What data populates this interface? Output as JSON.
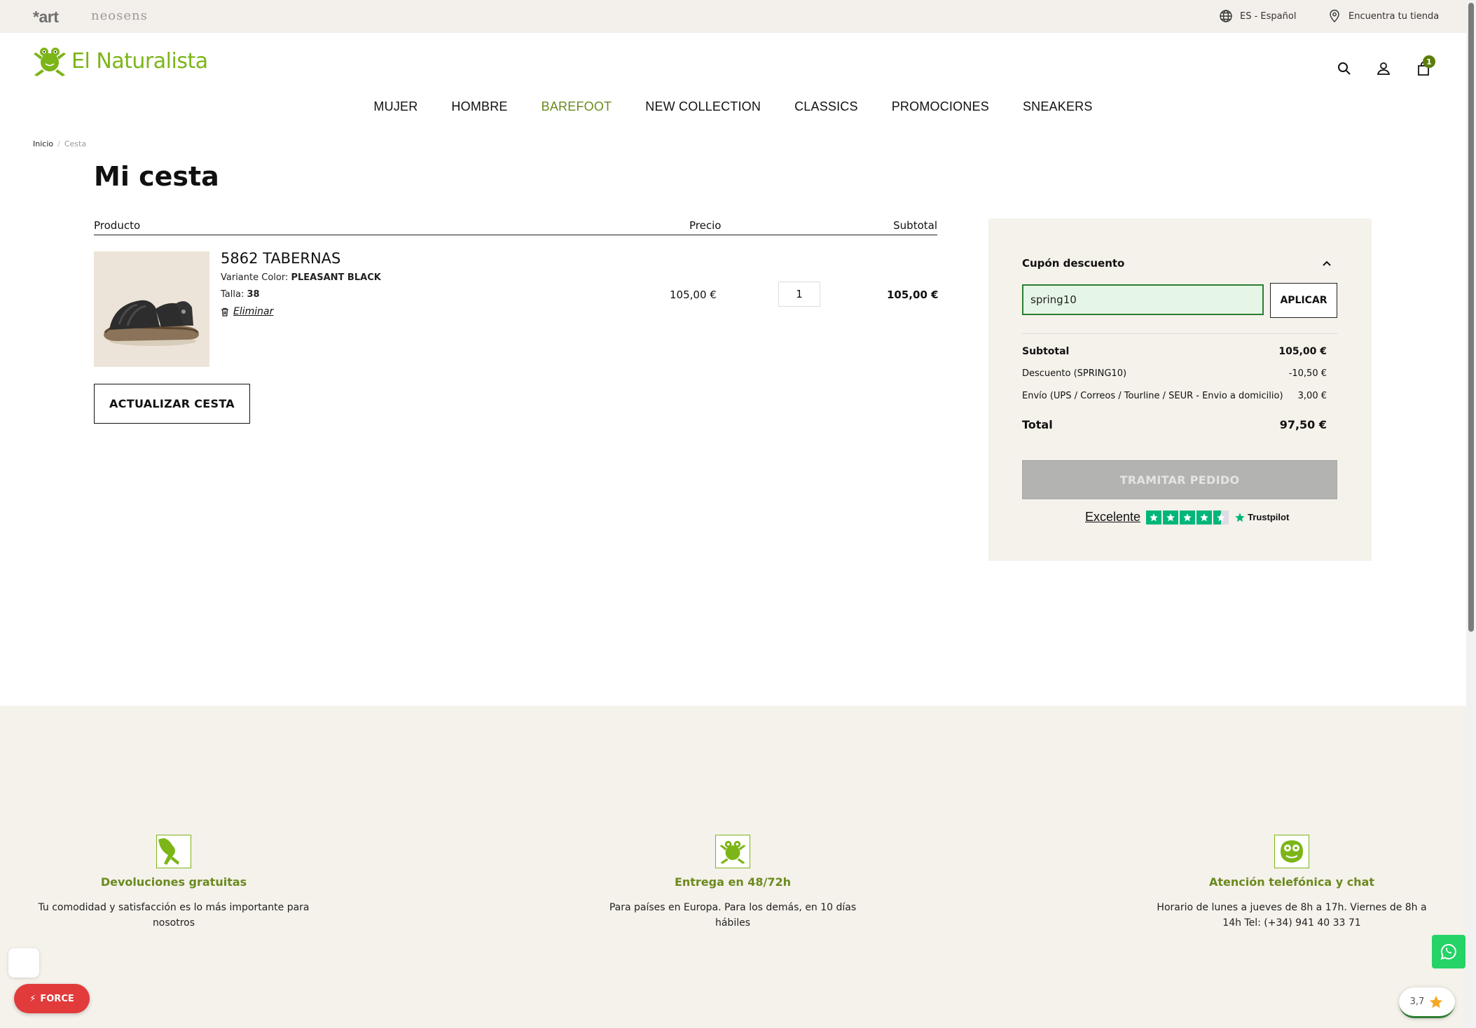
{
  "topbar": {
    "brand_art": "*art",
    "brand_neosens": "neosens",
    "language": "ES - Español",
    "store_locator": "Encuentra tu tienda"
  },
  "header": {
    "logo_text": "El Naturalista",
    "cart_count": "1"
  },
  "nav": {
    "items": [
      {
        "label": "MUJER"
      },
      {
        "label": "HOMBRE"
      },
      {
        "label": "BAREFOOT"
      },
      {
        "label": "NEW COLLECTION"
      },
      {
        "label": "CLASSICS"
      },
      {
        "label": "PROMOCIONES"
      },
      {
        "label": "SNEAKERS"
      }
    ]
  },
  "breadcrumb": {
    "home": "Inicio",
    "sep": "/",
    "current": "Cesta"
  },
  "page_title": "Mi cesta",
  "cart": {
    "columns": {
      "product": "Producto",
      "price": "Precio",
      "subtotal": "Subtotal"
    },
    "item": {
      "name": "5862 TABERNAS",
      "variant_label": "Variante Color:",
      "variant_value": "PLEASANT BLACK",
      "size_label": "Talla:",
      "size_value": "38",
      "remove": "Eliminar",
      "price": "105,00 €",
      "qty": "1",
      "subtotal": "105,00 €"
    },
    "update_button": "ACTUALIZAR CESTA"
  },
  "summary": {
    "coupon_title": "Cupón descuento",
    "coupon_value": "spring10",
    "apply_button": "APLICAR",
    "subtotal_label": "Subtotal",
    "subtotal_value": "105,00 €",
    "discount_label": "Descuento (SPRING10)",
    "discount_value": "-10,50 €",
    "shipping_label": "Envío (UPS / Correos / Tourline / SEUR - Envio a domicilio)",
    "shipping_value": "3,00 €",
    "total_label": "Total",
    "total_value": "97,50 €",
    "checkout_button": "TRAMITAR PEDIDO",
    "trustpilot_word": "Excelente",
    "trustpilot_brand": "Trustpilot"
  },
  "features": [
    {
      "title": "Devoluciones gratuitas",
      "desc": "Tu comodidad y satisfacción es lo más importante para nosotros"
    },
    {
      "title": "Entrega en 48/72h",
      "desc": "Para países en Europa. Para los demás, en 10 días hábiles"
    },
    {
      "title": "Atención telefónica y chat",
      "desc": "Horario de lunes a jueves de 8h a 17h. Viernes de 8h a 14h Tel: (+34) 941 40 33 71"
    }
  ],
  "widgets": {
    "rating": "3,7",
    "force_label": "FORCE"
  },
  "colors": {
    "brand_green": "#7cb518",
    "nav_accent": "#6a8a1e",
    "coupon_border": "#2e7d32",
    "checkout_disabled": "#b3b3b1",
    "trustpilot_green": "#00b67a",
    "footer_bg": "#f5f1eb"
  }
}
